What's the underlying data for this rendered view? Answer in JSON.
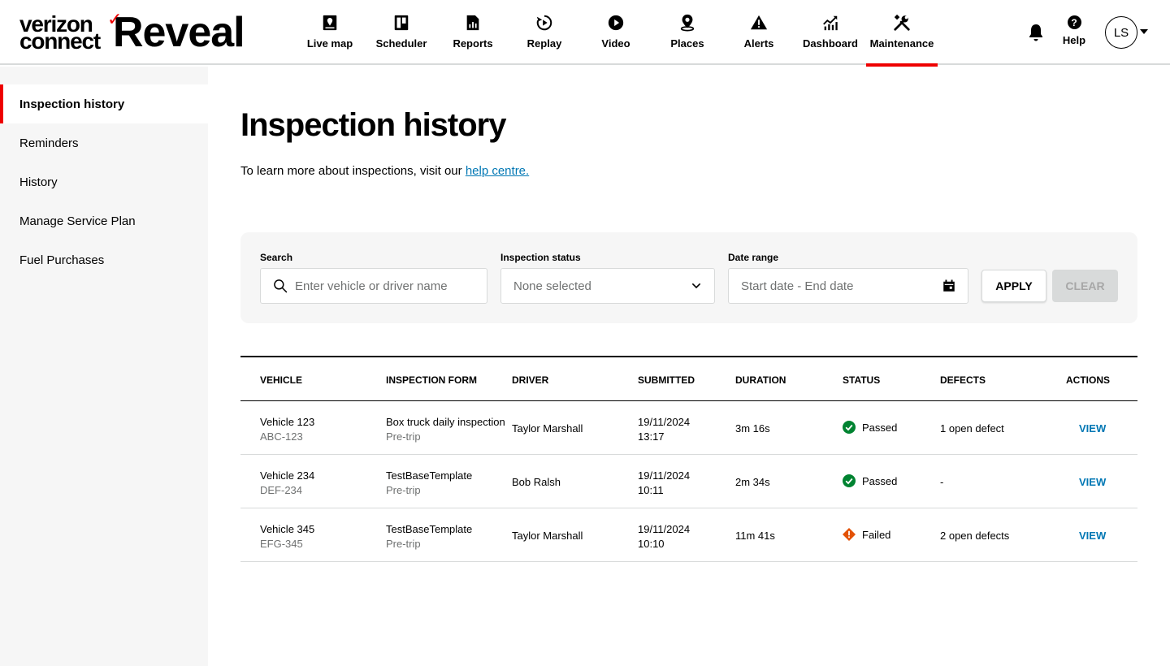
{
  "brand": {
    "vz_line1": "verizon",
    "vz_line2": "connect",
    "product": "Reveal"
  },
  "nav": {
    "items": [
      {
        "label": "Live map",
        "icon": "map-pin-icon"
      },
      {
        "label": "Scheduler",
        "icon": "scheduler-icon"
      },
      {
        "label": "Reports",
        "icon": "reports-icon"
      },
      {
        "label": "Replay",
        "icon": "replay-icon"
      },
      {
        "label": "Video",
        "icon": "video-icon"
      },
      {
        "label": "Places",
        "icon": "places-icon"
      },
      {
        "label": "Alerts",
        "icon": "alert-icon"
      },
      {
        "label": "Dashboard",
        "icon": "dashboard-icon"
      },
      {
        "label": "Maintenance",
        "icon": "wrench-icon"
      }
    ],
    "active": "Maintenance",
    "help_label": "Help",
    "avatar_initials": "LS"
  },
  "sidebar": {
    "items": [
      {
        "label": "Inspection history"
      },
      {
        "label": "Reminders"
      },
      {
        "label": "History"
      },
      {
        "label": "Manage Service Plan"
      },
      {
        "label": "Fuel Purchases"
      }
    ]
  },
  "page": {
    "title": "Inspection history",
    "intro_text": "To learn more about inspections, visit our ",
    "intro_link": "help centre."
  },
  "filters": {
    "search_label": "Search",
    "search_placeholder": "Enter vehicle or driver name",
    "status_label": "Inspection status",
    "status_value": "None selected",
    "date_label": "Date range",
    "date_placeholder": "Start date - End date",
    "apply_label": "APPLY",
    "clear_label": "CLEAR"
  },
  "table": {
    "headers": {
      "vehicle": "VEHICLE",
      "form": "INSPECTION FORM",
      "driver": "DRIVER",
      "submitted": "SUBMITTED",
      "duration": "DURATION",
      "status": "STATUS",
      "defects": "DEFECTS",
      "actions": "ACTIONS"
    },
    "rows": [
      {
        "vehicle": "Vehicle 123",
        "plate": "ABC-123",
        "form": "Box truck daily inspection",
        "form_type": "Pre-trip",
        "driver": "Taylor Marshall",
        "date": "19/11/2024",
        "time": "13:17",
        "duration": "3m 16s",
        "status": "Passed",
        "defects": "1 open defect",
        "action": "VIEW"
      },
      {
        "vehicle": "Vehicle 234",
        "plate": "DEF-234",
        "form": "TestBaseTemplate",
        "form_type": "Pre-trip",
        "driver": "Bob Ralsh",
        "date": "19/11/2024",
        "time": "10:11",
        "duration": "2m 34s",
        "status": "Passed",
        "defects": "-",
        "action": "VIEW"
      },
      {
        "vehicle": "Vehicle 345",
        "plate": "EFG-345",
        "form": "TestBaseTemplate",
        "form_type": "Pre-trip",
        "driver": "Taylor Marshall",
        "date": "19/11/2024",
        "time": "10:10",
        "duration": "11m 41s",
        "status": "Failed",
        "defects": "2 open defects",
        "action": "VIEW"
      }
    ]
  },
  "colors": {
    "accent": "#ee0000",
    "link": "#0077b4",
    "passed": "#008331",
    "failed": "#e35205"
  }
}
